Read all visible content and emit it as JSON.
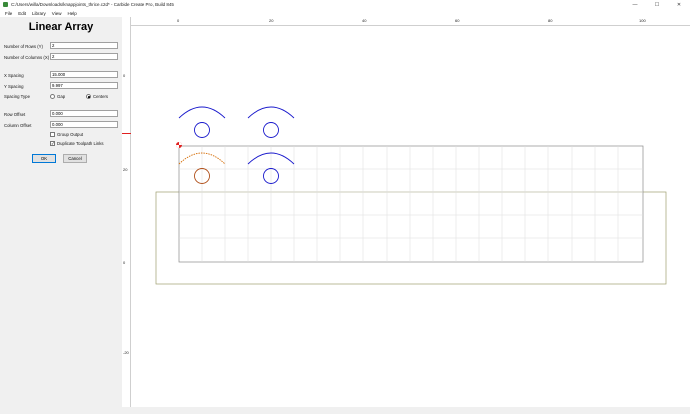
{
  "window": {
    "title": "C:/Users/willa/Downloads/knappjoints_thrice.c2d* - Carbide Create Pro, Build 845",
    "minimize_glyph": "—",
    "maximize_glyph": "☐",
    "close_glyph": "✕"
  },
  "menu": [
    "File",
    "Edit",
    "Library",
    "View",
    "Help"
  ],
  "panel": {
    "title": "Linear Array",
    "rows_label": "Number of Rows (Y)",
    "rows_value": "2",
    "cols_label": "Number of Columns (X)",
    "cols_value": "2",
    "x_spacing_label": "X Spacing",
    "x_spacing_value": "15.000",
    "y_spacing_label": "Y Spacing",
    "y_spacing_value": "9.997",
    "spacing_type_label": "Spacing Type",
    "gap_label": "Gap",
    "centers_label": "Centers",
    "spacing_type_selected": "Centers",
    "row_offset_label": "Row Offset",
    "row_offset_value": "0.000",
    "col_offset_label": "Column Offset",
    "col_offset_value": "0.000",
    "group_output_label": "Group Output",
    "group_output_checked": false,
    "dup_links_label": "Duplicate Toolpath Links",
    "dup_links_checked": true,
    "check_glyph": "✓",
    "ok_label": "OK",
    "cancel_label": "Cancel"
  },
  "rulers": {
    "top": [
      "0",
      "20",
      "40",
      "60",
      "80",
      "100"
    ],
    "left": [
      "0",
      "20",
      "0",
      "-20"
    ]
  },
  "colors": {
    "selected_shape": "#1a1acc",
    "highlight_shape": "#d46a00",
    "stock_border": "#9e9e6e",
    "grid": "#d8d8d8",
    "origin_marker": "#e02020"
  }
}
